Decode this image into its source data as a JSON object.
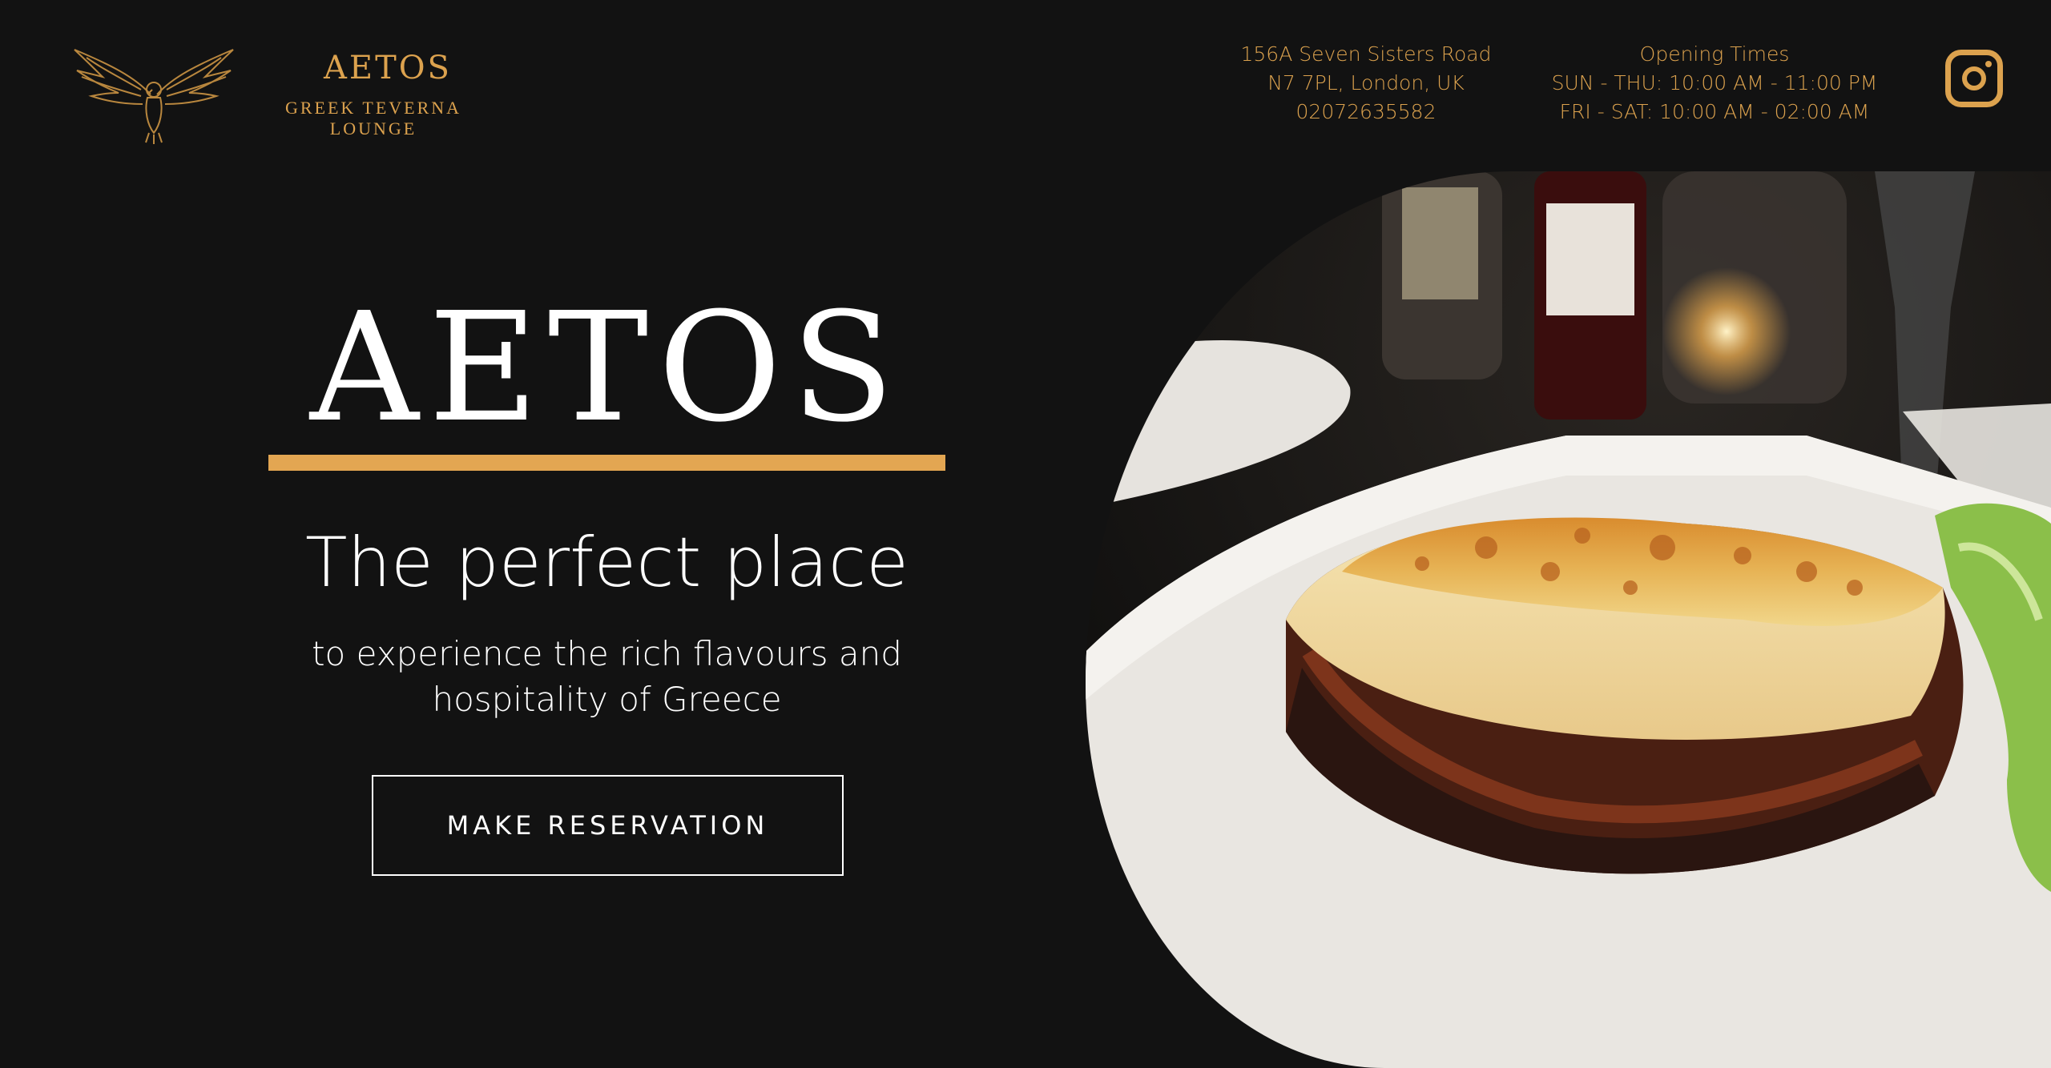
{
  "header": {
    "logo": {
      "name": "AETOS",
      "subtitle_line1": "GREEK TEVERNA",
      "subtitle_line2": "LOUNGE",
      "icon": "eagle-logo-icon"
    },
    "address": {
      "line1": "156A Seven Sisters Road",
      "line2": "N7 7PL, London, UK",
      "phone": "02072635582"
    },
    "opening_times": {
      "title": "Opening Times",
      "line1": "SUN - THU: 10:00 AM - 11:00 PM",
      "line2": "FRI - SAT: 10:00 AM - 02:00 AM"
    },
    "social": {
      "icon": "instagram-icon"
    }
  },
  "hero": {
    "title": "AETOS",
    "tagline": "The perfect place",
    "description_line1": "to experience the rich flavours and",
    "description_line2": "hospitality of Greece",
    "cta_label": "MAKE RESERVATION",
    "image_subject": "moussaka on a white plate"
  },
  "colors": {
    "background": "#121212",
    "accent": "#dca24e",
    "text": "#ffffff"
  }
}
